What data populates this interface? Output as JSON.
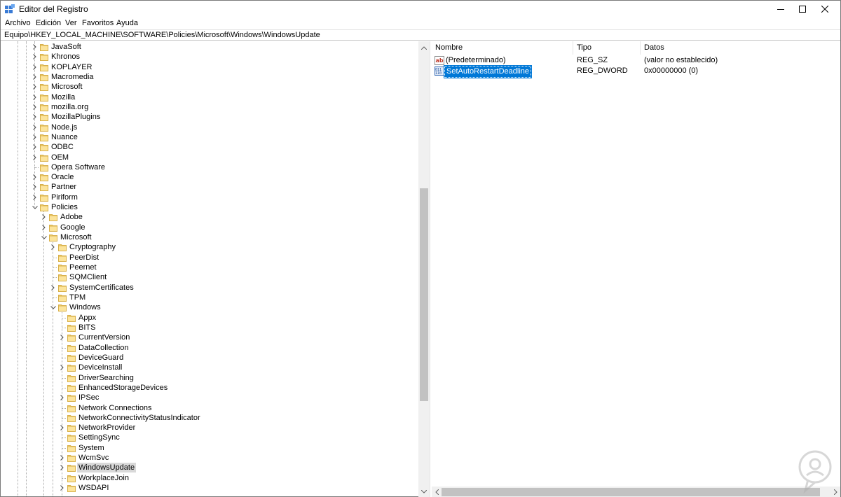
{
  "window": {
    "title": "Editor del Registro",
    "controls": {
      "minimize": "minimize-icon",
      "maximize": "maximize-icon",
      "close": "close-icon"
    }
  },
  "menu": [
    "Archivo",
    "Edición",
    "Ver",
    "Favoritos",
    "Ayuda"
  ],
  "address": "Equipo\\HKEY_LOCAL_MACHINE\\SOFTWARE\\Policies\\Microsoft\\Windows\\WindowsUpdate",
  "tree": [
    {
      "label": "JavaSoft",
      "level": 0,
      "expander": "collapsed"
    },
    {
      "label": "Khronos",
      "level": 0,
      "expander": "collapsed"
    },
    {
      "label": "KOPLAYER",
      "level": 0,
      "expander": "collapsed"
    },
    {
      "label": "Macromedia",
      "level": 0,
      "expander": "collapsed"
    },
    {
      "label": "Microsoft",
      "level": 0,
      "expander": "collapsed"
    },
    {
      "label": "Mozilla",
      "level": 0,
      "expander": "collapsed"
    },
    {
      "label": "mozilla.org",
      "level": 0,
      "expander": "collapsed"
    },
    {
      "label": "MozillaPlugins",
      "level": 0,
      "expander": "collapsed"
    },
    {
      "label": "Node.js",
      "level": 0,
      "expander": "collapsed"
    },
    {
      "label": "Nuance",
      "level": 0,
      "expander": "collapsed"
    },
    {
      "label": "ODBC",
      "level": 0,
      "expander": "collapsed"
    },
    {
      "label": "OEM",
      "level": 0,
      "expander": "collapsed"
    },
    {
      "label": "Opera Software",
      "level": 0,
      "expander": "none"
    },
    {
      "label": "Oracle",
      "level": 0,
      "expander": "collapsed"
    },
    {
      "label": "Partner",
      "level": 0,
      "expander": "collapsed"
    },
    {
      "label": "Piriform",
      "level": 0,
      "expander": "collapsed"
    },
    {
      "label": "Policies",
      "level": 0,
      "expander": "expanded"
    },
    {
      "label": "Adobe",
      "level": 1,
      "expander": "collapsed"
    },
    {
      "label": "Google",
      "level": 1,
      "expander": "collapsed"
    },
    {
      "label": "Microsoft",
      "level": 1,
      "expander": "expanded"
    },
    {
      "label": "Cryptography",
      "level": 2,
      "expander": "collapsed"
    },
    {
      "label": "PeerDist",
      "level": 2,
      "expander": "none"
    },
    {
      "label": "Peernet",
      "level": 2,
      "expander": "none"
    },
    {
      "label": "SQMClient",
      "level": 2,
      "expander": "none"
    },
    {
      "label": "SystemCertificates",
      "level": 2,
      "expander": "collapsed"
    },
    {
      "label": "TPM",
      "level": 2,
      "expander": "none"
    },
    {
      "label": "Windows",
      "level": 2,
      "expander": "expanded"
    },
    {
      "label": "Appx",
      "level": 3,
      "expander": "none"
    },
    {
      "label": "BITS",
      "level": 3,
      "expander": "none"
    },
    {
      "label": "CurrentVersion",
      "level": 3,
      "expander": "collapsed"
    },
    {
      "label": "DataCollection",
      "level": 3,
      "expander": "none"
    },
    {
      "label": "DeviceGuard",
      "level": 3,
      "expander": "none"
    },
    {
      "label": "DeviceInstall",
      "level": 3,
      "expander": "collapsed"
    },
    {
      "label": "DriverSearching",
      "level": 3,
      "expander": "none"
    },
    {
      "label": "EnhancedStorageDevices",
      "level": 3,
      "expander": "none"
    },
    {
      "label": "IPSec",
      "level": 3,
      "expander": "collapsed"
    },
    {
      "label": "Network Connections",
      "level": 3,
      "expander": "none"
    },
    {
      "label": "NetworkConnectivityStatusIndicator",
      "level": 3,
      "expander": "none"
    },
    {
      "label": "NetworkProvider",
      "level": 3,
      "expander": "collapsed"
    },
    {
      "label": "SettingSync",
      "level": 3,
      "expander": "none"
    },
    {
      "label": "System",
      "level": 3,
      "expander": "none"
    },
    {
      "label": "WcmSvc",
      "level": 3,
      "expander": "collapsed"
    },
    {
      "label": "WindowsUpdate",
      "level": 3,
      "expander": "collapsed",
      "selected": true
    },
    {
      "label": "WorkplaceJoin",
      "level": 3,
      "expander": "none"
    },
    {
      "label": "WSDAPI",
      "level": 3,
      "expander": "collapsed"
    }
  ],
  "values": {
    "headers": {
      "name": "Nombre",
      "type": "Tipo",
      "data": "Datos"
    },
    "rows": [
      {
        "name": "(Predeterminado)",
        "type": "REG_SZ",
        "data": "(valor no establecido)",
        "icon": "string-value-icon",
        "selected": false
      },
      {
        "name": "SetAutoRestartDeadline",
        "type": "REG_DWORD",
        "data": "0x00000000 (0)",
        "icon": "dword-value-icon",
        "selected": true
      }
    ]
  },
  "colors": {
    "selection": "#0078d7",
    "folder": "#f5d37a",
    "scroll_thumb": "#c2c2c2",
    "tree_selected": "#d9d9d9"
  }
}
